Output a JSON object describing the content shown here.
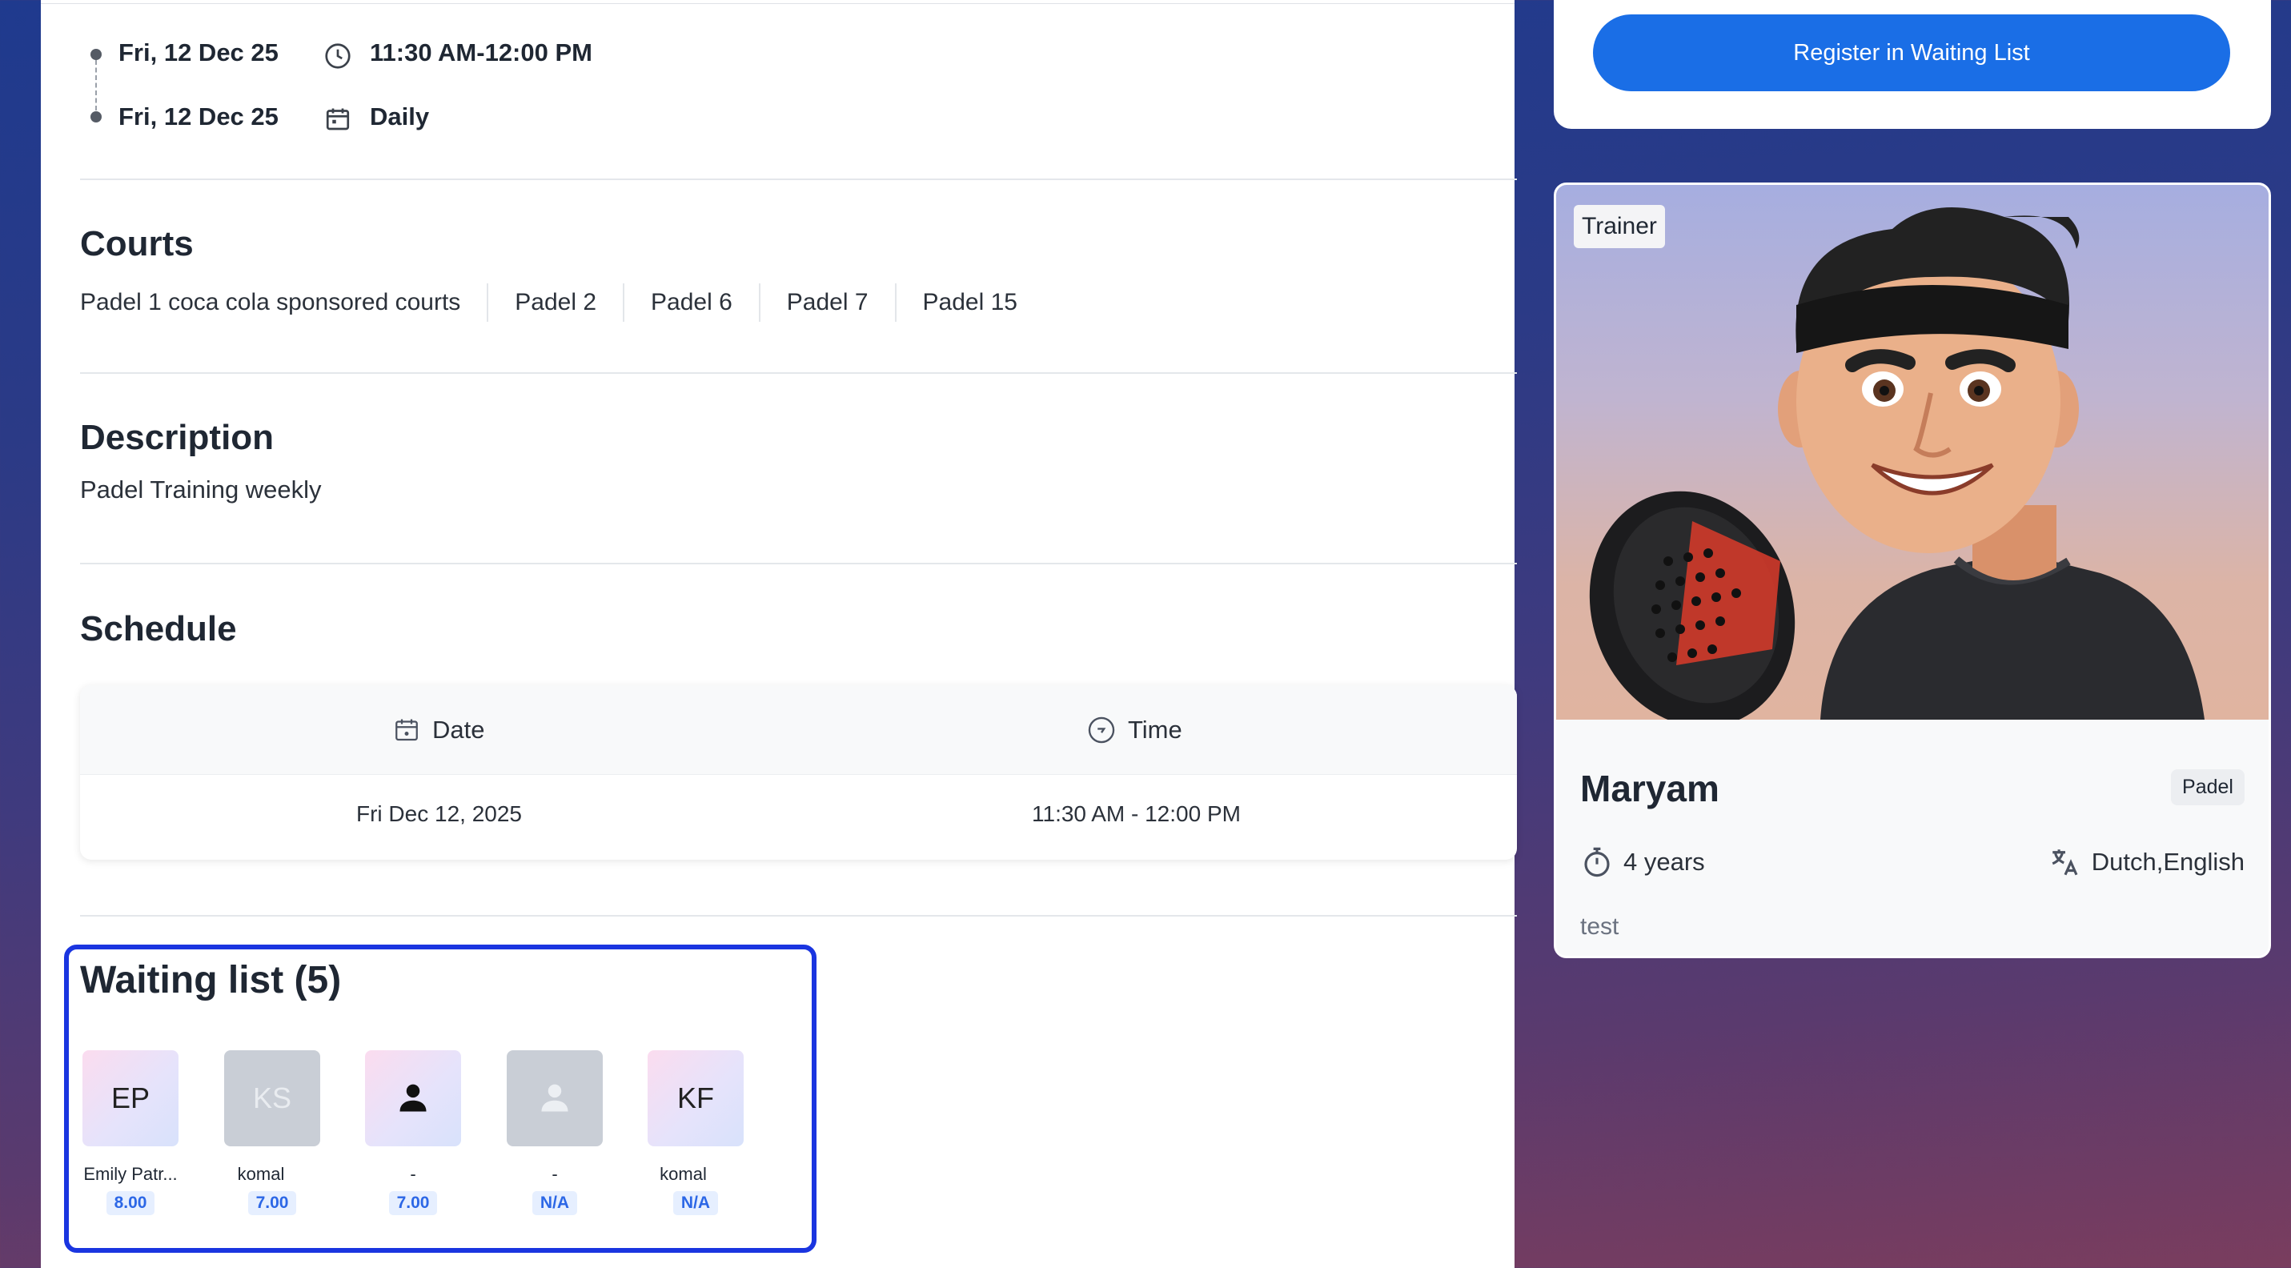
{
  "event": {
    "start_date": "Fri, 12 Dec 25",
    "end_date": "Fri, 12 Dec 25",
    "time_range": "11:30 AM-12:00 PM",
    "recurrence": "Daily"
  },
  "courts": {
    "title": "Courts",
    "items": [
      "Padel 1 coca cola sponsored courts",
      "Padel 2",
      "Padel 6",
      "Padel 7",
      "Padel 15"
    ]
  },
  "description": {
    "title": "Description",
    "text": "Padel Training weekly"
  },
  "schedule": {
    "title": "Schedule",
    "columns": [
      "Date",
      "Time"
    ],
    "rows": [
      {
        "date": "Fri Dec 12, 2025",
        "time": "11:30 AM - 12:00 PM"
      }
    ]
  },
  "waiting_list": {
    "title": "Waiting list (5)",
    "members": [
      {
        "initials": "EP",
        "name": "Emily Patr...",
        "score": "8.00",
        "avatar": "initials-gradient"
      },
      {
        "initials": "KS",
        "name": "komal",
        "score": "7.00",
        "avatar": "initials-gray"
      },
      {
        "initials": "",
        "name": "-",
        "score": "7.00",
        "avatar": "person-icon-gradient"
      },
      {
        "initials": "",
        "name": "-",
        "score": "N/A",
        "avatar": "person-icon-gray"
      },
      {
        "initials": "KF",
        "name": "komal",
        "score": "N/A",
        "avatar": "initials-gradient"
      }
    ]
  },
  "register": {
    "button_label": "Register in Waiting List"
  },
  "trainer": {
    "tag": "Trainer",
    "name": "Maryam",
    "sport": "Padel",
    "experience": "4 years",
    "languages": "Dutch,English",
    "bio": "test",
    "photo": "cartoon-trainer-with-padel-racket"
  },
  "colors": {
    "primary_button": "#1a6ee6",
    "highlight_border": "#1a35e0",
    "score_badge_text": "#2c67e6"
  }
}
